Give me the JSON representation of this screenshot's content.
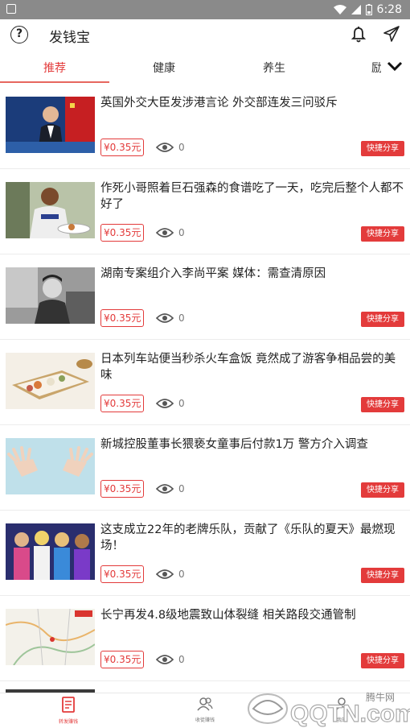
{
  "status_bar": {
    "time": "6:28"
  },
  "app_bar": {
    "title": "发钱宝",
    "help_glyph": "?"
  },
  "tabs": [
    {
      "label": "推荐",
      "active": true
    },
    {
      "label": "健康",
      "active": false
    },
    {
      "label": "养生",
      "active": false
    },
    {
      "label": "励",
      "active": false
    }
  ],
  "articles": [
    {
      "title": "英国外交大臣发涉港言论 外交部连发三问驳斥",
      "price": "¥0.35元",
      "views": "0",
      "share_label": "快捷分享",
      "thumb_icon": "press-conference-photo"
    },
    {
      "title": "作死小哥照着巨石强森的食谱吃了一天，吃完后整个人都不好了",
      "price": "¥0.35元",
      "views": "0",
      "share_label": "快捷分享",
      "thumb_icon": "man-eating-photo"
    },
    {
      "title": "湖南专案组介入李尚平案 媒体：需查清原因",
      "price": "¥0.35元",
      "views": "0",
      "share_label": "快捷分享",
      "thumb_icon": "portrait-photo"
    },
    {
      "title": "日本列车站便当秒杀火车盒饭 竟然成了游客争相品尝的美味",
      "price": "¥0.35元",
      "views": "0",
      "share_label": "快捷分享",
      "thumb_icon": "bento-photo"
    },
    {
      "title": "新城控股董事长猥亵女童事后付款1万 警方介入调查",
      "price": "¥0.35元",
      "views": "0",
      "share_label": "快捷分享",
      "thumb_icon": "hands-photo"
    },
    {
      "title": "这支成立22年的老牌乐队，贡献了《乐队的夏天》最燃现场！",
      "price": "¥0.35元",
      "views": "0",
      "share_label": "快捷分享",
      "thumb_icon": "band-photo"
    },
    {
      "title": "长宁再发4.8级地震致山体裂缝 相关路段交通管制",
      "price": "¥0.35元",
      "views": "0",
      "share_label": "快捷分享",
      "thumb_icon": "map-photo"
    }
  ],
  "bottom_nav": [
    {
      "label": "转发赚钱",
      "active": true
    },
    {
      "label": "收徒赚钱",
      "active": false
    },
    {
      "label": "我的",
      "active": false
    }
  ],
  "watermark": {
    "brand": "腾牛网",
    "site": "QQTN.com"
  },
  "colors": {
    "accent": "#e33b3b",
    "tab_indicator": "#e7675f",
    "statusbar": "#8a8a8a"
  }
}
